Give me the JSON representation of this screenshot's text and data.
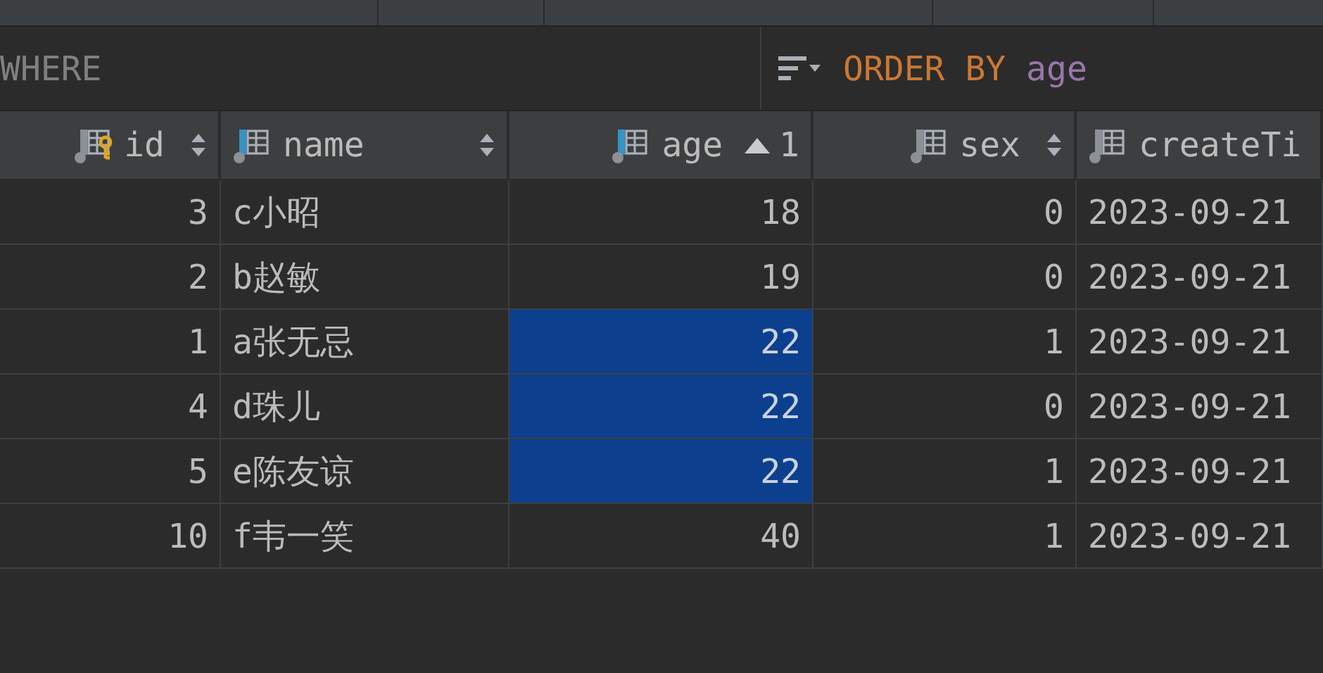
{
  "filter": {
    "where": "WHERE",
    "order_keyword": "ORDER BY",
    "order_column": "age"
  },
  "columns": [
    {
      "label": "id",
      "kind": "key",
      "sorted": false,
      "numeric": true
    },
    {
      "label": "name",
      "kind": "indexed",
      "sorted": false,
      "numeric": false
    },
    {
      "label": "age",
      "kind": "indexed",
      "sorted": true,
      "sort_rank": "1",
      "numeric": true
    },
    {
      "label": "sex",
      "kind": "plain",
      "sorted": false,
      "numeric": true
    },
    {
      "label": "createTi",
      "kind": "plain",
      "numeric": false
    }
  ],
  "rows": [
    {
      "cells": [
        "3",
        "c小昭",
        "18",
        "0",
        "2023-09-21"
      ],
      "age_selected": false
    },
    {
      "cells": [
        "2",
        "b赵敏",
        "19",
        "0",
        "2023-09-21"
      ],
      "age_selected": false
    },
    {
      "cells": [
        "1",
        "a张无忌",
        "22",
        "1",
        "2023-09-21"
      ],
      "age_selected": true
    },
    {
      "cells": [
        "4",
        "d珠儿",
        "22",
        "0",
        "2023-09-21"
      ],
      "age_selected": true
    },
    {
      "cells": [
        "5",
        "e陈友谅",
        "22",
        "1",
        "2023-09-21"
      ],
      "age_selected": true
    },
    {
      "cells": [
        "10",
        "f韦一笑",
        "40",
        "1",
        "2023-09-21"
      ],
      "age_selected": false
    }
  ]
}
